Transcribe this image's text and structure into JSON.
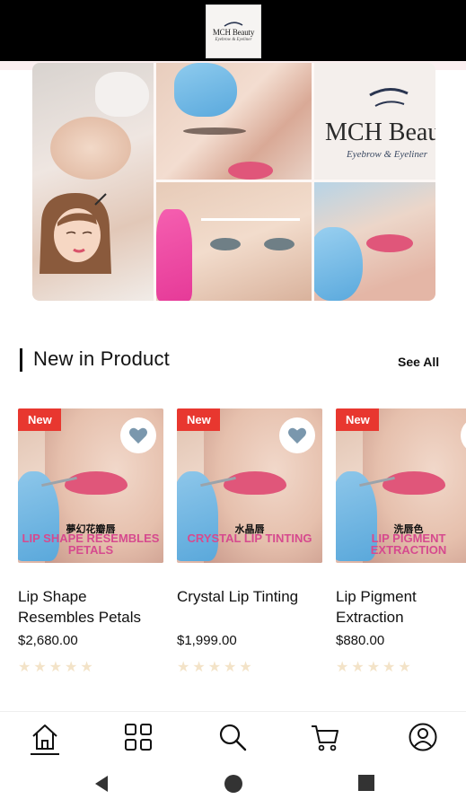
{
  "brand": {
    "logo_text": "MCH Beauty",
    "logo_sub": "Eyebrow & Eyeliner",
    "banner_text": "MCH Beau",
    "banner_script": "Eyebrow & Eyeliner"
  },
  "section": {
    "title": "New in Product",
    "see_all": "See All"
  },
  "products": [
    {
      "badge": "New",
      "name": "Lip Shape Resembles Petals",
      "price": "$2,680.00",
      "image_cn": "夢幻花瓣唇",
      "image_en": "LIP SHAPE RESEMBLES PETALS",
      "rating": 0
    },
    {
      "badge": "New",
      "name": "Crystal Lip Tinting",
      "price": "$1,999.00",
      "image_cn": "水晶唇",
      "image_en": "CRYSTAL LIP TINTING",
      "rating": 0
    },
    {
      "badge": "New",
      "name": "Lip Pigment Extraction",
      "price": "$880.00",
      "image_cn": "洗唇色",
      "image_en": "LIP PIGMENT EXTRACTION",
      "rating": 0
    }
  ],
  "bottom_nav": [
    {
      "icon": "home-icon",
      "active": true
    },
    {
      "icon": "categories-icon",
      "active": false
    },
    {
      "icon": "search-icon",
      "active": false
    },
    {
      "icon": "cart-icon",
      "active": false
    },
    {
      "icon": "profile-icon",
      "active": false
    }
  ],
  "system_nav": [
    "back-icon",
    "home-circle-icon",
    "recents-icon"
  ],
  "colors": {
    "badge": "#e8372f",
    "accent_pink": "#d64a8e",
    "star_empty": "#f3e3c8"
  }
}
